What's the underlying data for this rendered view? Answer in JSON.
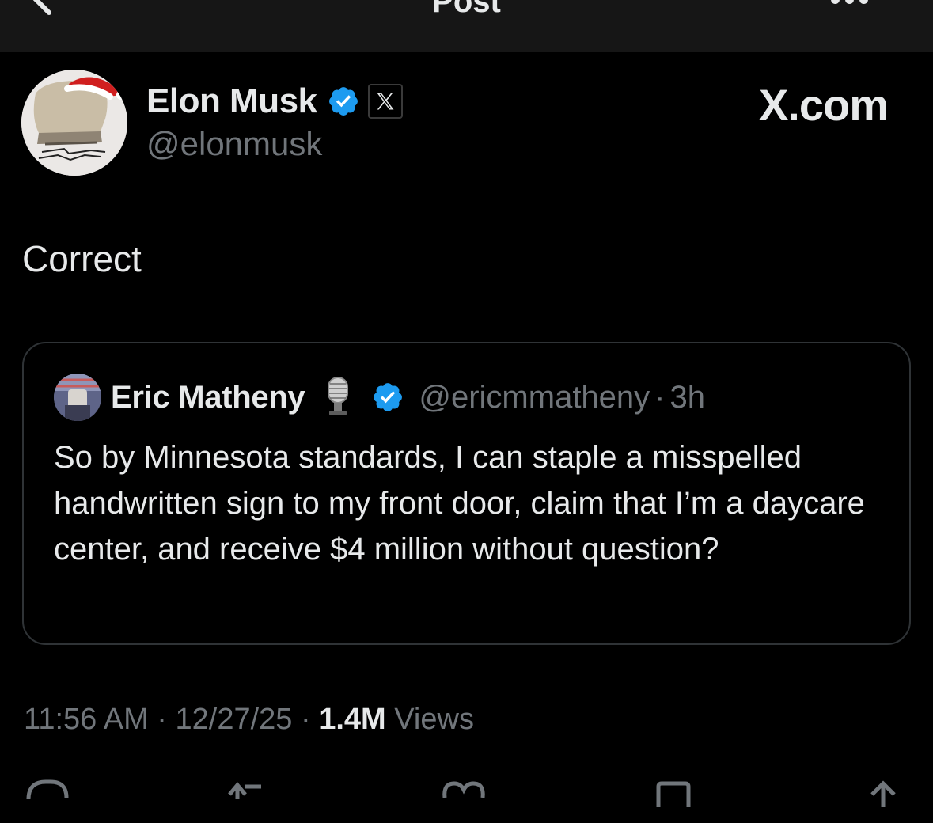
{
  "topbar": {
    "title": "Post",
    "back_icon": "arrow-left-icon",
    "more_icon": "more-horizontal-icon"
  },
  "author": {
    "name": "Elon Musk",
    "handle": "@elonmusk",
    "verified_icon": "verified-badge-icon",
    "affiliation_icon": "x-logo-icon",
    "affiliation_site": "X.com",
    "verified_color": "#1d9bf0"
  },
  "post": {
    "text": "Correct"
  },
  "quote": {
    "name": "Eric Matheny",
    "emoji_icon": "microphone-icon",
    "handle": "@ericmmatheny",
    "separator": "·",
    "time": "3h",
    "text": "So by Minnesota standards, I can staple a misspelled handwritten sign to my front door, claim that I’m a daycare center, and receive $4 million without question?"
  },
  "meta": {
    "time": "11:56 AM",
    "date": "12/27/25",
    "separator": "·",
    "views_count": "1.4M",
    "views_label": "Views"
  },
  "colors": {
    "background": "#000000",
    "text": "#e7e9ea",
    "secondary": "#71767b",
    "border": "#2f3336",
    "topbar": "#161616"
  }
}
